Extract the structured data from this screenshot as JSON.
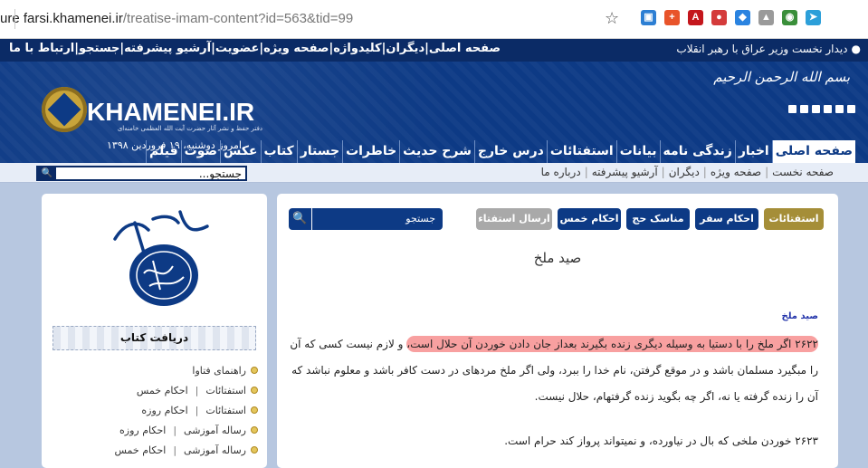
{
  "browser": {
    "url_host": "ure  farsi.khamenei.ir",
    "url_path": "/treatise-imam-content?id=563&tid=99",
    "extensions": [
      {
        "name": "picture-icon",
        "glyph": "▣",
        "color": "#2d7fd3"
      },
      {
        "name": "plus-icon",
        "glyph": "+",
        "color": "#e8542a"
      },
      {
        "name": "pdf-icon",
        "glyph": "A",
        "color": "#c4161c"
      },
      {
        "name": "record-icon",
        "glyph": "●",
        "color": "#d43b3b"
      },
      {
        "name": "dropbox-icon",
        "glyph": "◆",
        "color": "#2a83e0"
      },
      {
        "name": "drive-icon",
        "glyph": "▲",
        "color": "#9a9a9a"
      },
      {
        "name": "globe-icon",
        "glyph": "◉",
        "color": "#3a8f3a"
      },
      {
        "name": "telegram-icon",
        "glyph": "➤",
        "color": "#2c9fd9"
      }
    ]
  },
  "topbar": {
    "news": "دیدار نخست وزیر عراق با رهبر انقلاب",
    "links": "صفحه اصلی|دیگران|کلیدواژه|صفحه ویژه|عضویت|آرشیو پیشرفته|جستجو|ارتباط با ما"
  },
  "header": {
    "logo_text": "KHAMENEI.IR",
    "logo_sub": "دفتر حفظ و نشر آثار حضرت آیت الله العظمی خامنه‌ای",
    "date": "امروز دوشنبه، ۱۹ فروردین ۱۳۹۸",
    "bismillah": "بسم الله الرحمن الرحیم",
    "nav": [
      "صفحه اصلی",
      "اخبار",
      "زندگی نامه",
      "بیانات",
      "استفتائات",
      "درس خارج",
      "شرح حدیث",
      "خاطرات",
      "جستار",
      "کتاب",
      "عکس",
      "صوت",
      "فیلم"
    ]
  },
  "subnav": {
    "links": [
      "صفحه نخست",
      "صفحه ویژه",
      "دیگران",
      "آرشیو پیشرفته",
      "درباره ما"
    ],
    "search_value": "جستجو..."
  },
  "sidebar": {
    "books_title": "دریافت کتاب",
    "items": [
      {
        "a": "راهنمای فتاوا",
        "b": ""
      },
      {
        "a": "استفتائات",
        "b": "احکام خمس"
      },
      {
        "a": "استفتائات",
        "b": "احکام روزه"
      },
      {
        "a": "رساله آموزشی",
        "b": "احکام روزه"
      },
      {
        "a": "رساله آموزشی",
        "b": "احکام خمس"
      }
    ]
  },
  "content": {
    "buttons": [
      {
        "label": "استفتائات",
        "color": "#a58e38"
      },
      {
        "label": "احکام سفر",
        "color": "#0d3a85"
      },
      {
        "label": "مناسک حج",
        "color": "#0d3a85"
      },
      {
        "label": "احکام خمس",
        "color": "#0d3a85"
      },
      {
        "label": "ارسال استفتاء",
        "color": "#a9a9a9"
      }
    ],
    "search_placeholder": "جستجو",
    "title": "صید ملخ",
    "small_title": "صید ملخ",
    "para1_hl": "۲۶۲۲ اگر ملخ را با دستیا به وسیله دیگری زنده بگیرند بعداز جان دادن خوردن آن حلال است،",
    "para1_rest": " و لازم نیست کسی که آن را مبگیرد مسلمان باشد و در موقع گرفتن، نام خدا را ببرد، ولی اگر ملخ مردهای در دست کافر باشد و معلوم نباشد که آن را زنده گرفته یا نه، اگر چه بگوید زنده گرفتهام، حلال نیست.",
    "para2": "۲۶۲۳ خوردن ملخی که بال در نیاورده، و نمیتواند پرواز کند حرام است."
  }
}
